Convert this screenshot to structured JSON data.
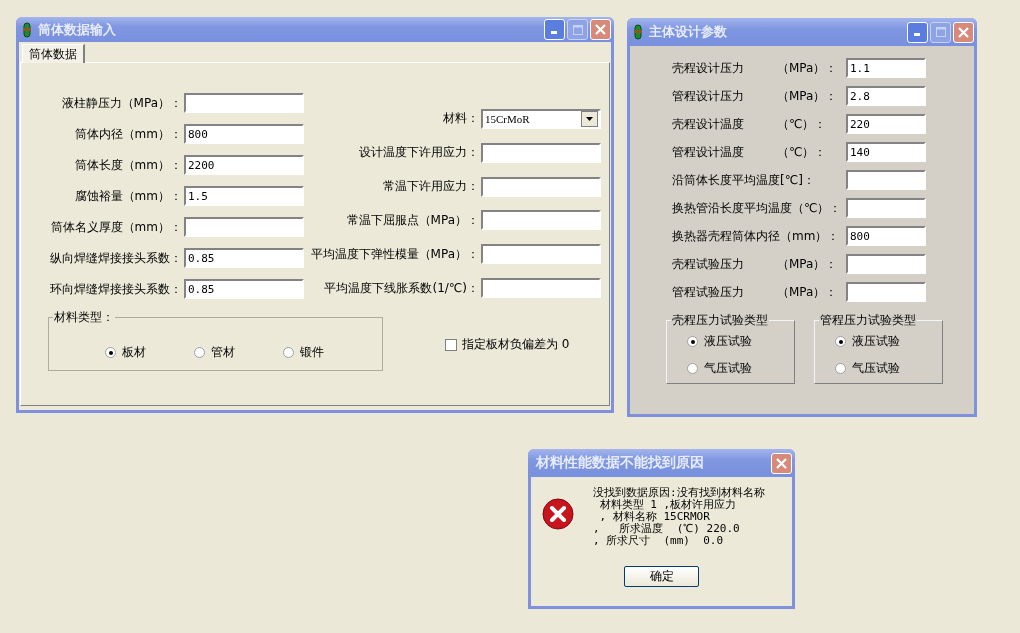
{
  "cylinder_window": {
    "title": "筒体数据输入",
    "tabs": [
      {
        "label": "筒体数据",
        "selected": true
      }
    ],
    "left_fields": [
      {
        "label": "液柱静压力（MPa）："
      },
      {
        "label": "筒体内径（mm）：",
        "value": "800"
      },
      {
        "label": "筒体长度（mm）：",
        "value": "2200"
      },
      {
        "label": "腐蚀裕量（mm）：",
        "value": "1.5"
      },
      {
        "label": "筒体名义厚度（mm）："
      },
      {
        "label": "纵向焊缝焊接接头系数：",
        "value": "0.85"
      },
      {
        "label": "环向焊缝焊接接头系数：",
        "value": "0.85"
      }
    ],
    "right_fields": [
      {
        "label": "材料：",
        "kind": "dropdown",
        "value": "15CrMoR"
      },
      {
        "label": "设计温度下许用应力：",
        "kind": "text"
      },
      {
        "label": "常温下许用应力：",
        "kind": "text"
      },
      {
        "label": "常温下屈服点（MPa）：",
        "kind": "text"
      },
      {
        "label": "平均温度下弹性模量（MPa）：",
        "kind": "text"
      },
      {
        "label": "平均温度下线胀系数(1/℃)：",
        "kind": "text"
      }
    ],
    "material_type": {
      "legend": "材料类型：",
      "options": [
        {
          "label": "板材",
          "selected": true
        },
        {
          "label": "管材",
          "selected": false
        },
        {
          "label": "锻件",
          "selected": false
        }
      ]
    },
    "checkbox": {
      "label": "指定板材负偏差为 0",
      "checked": false
    }
  },
  "design_window": {
    "title": "主体设计参数",
    "fields": [
      {
        "label": "壳程设计压力",
        "unit": "（MPa）：",
        "value": "1.1"
      },
      {
        "label": "管程设计压力",
        "unit": "（MPa）：",
        "value": "2.8"
      },
      {
        "label": "壳程设计温度",
        "unit": "（℃）：",
        "value": "220"
      },
      {
        "label": "管程设计温度",
        "unit": "（℃）：",
        "value": "140"
      },
      {
        "label": "沿筒体长度平均温度[℃]："
      },
      {
        "label": "换热管沿长度平均温度（℃）："
      },
      {
        "label": "换热器壳程筒体内径（mm）：",
        "value": "800"
      },
      {
        "label": "壳程试验压力",
        "unit": "（MPa）："
      },
      {
        "label": "管程试验压力",
        "unit": "（MPa）："
      }
    ],
    "test_groups": [
      {
        "legend": "壳程压力试验类型",
        "options": [
          {
            "label": "液压试验",
            "selected": true
          },
          {
            "label": "气压试验",
            "selected": false
          }
        ]
      },
      {
        "legend": "管程压力试验类型",
        "options": [
          {
            "label": "液压试验",
            "selected": true
          },
          {
            "label": "气压试验",
            "selected": false
          }
        ]
      }
    ]
  },
  "error_dialog": {
    "title": "材料性能数据不能找到原因",
    "message_lines": [
      "没找到数据原因:没有找到材料名称",
      " 材料类型 1 ,板材许用应力",
      " , 材料名称 15CRMOR",
      ",   所求温度  (℃) 220.0",
      ", 所求尺寸  (mm)  0.0"
    ],
    "button": "确定"
  }
}
